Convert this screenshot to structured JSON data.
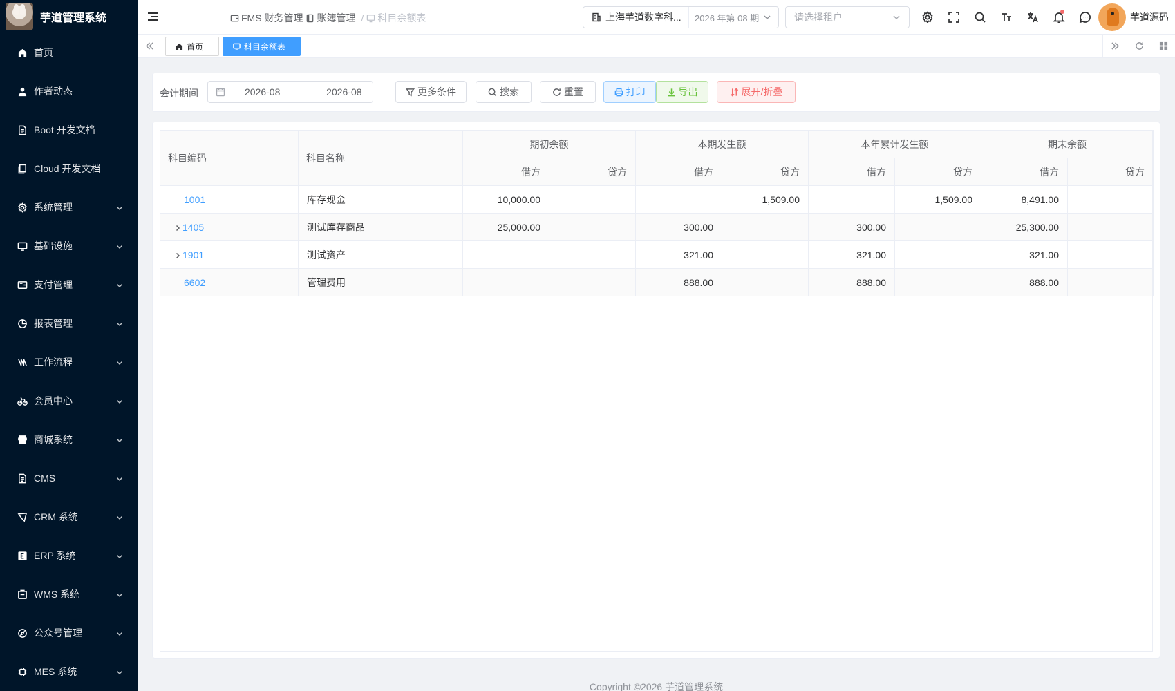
{
  "app": {
    "title": "芋道管理系统"
  },
  "sidebar": {
    "items": [
      {
        "label": "首页",
        "icon": "home-icon",
        "expandable": false
      },
      {
        "label": "作者动态",
        "icon": "user-icon",
        "expandable": false
      },
      {
        "label": "Boot 开发文档",
        "icon": "document-icon",
        "expandable": false
      },
      {
        "label": "Cloud 开发文档",
        "icon": "documents-icon",
        "expandable": false
      },
      {
        "label": "系统管理",
        "icon": "gear-icon",
        "expandable": true
      },
      {
        "label": "基础设施",
        "icon": "monitor-icon",
        "expandable": true
      },
      {
        "label": "支付管理",
        "icon": "wallet-icon",
        "expandable": true
      },
      {
        "label": "报表管理",
        "icon": "pie-chart-icon",
        "expandable": true
      },
      {
        "label": "工作流程",
        "icon": "workflow-icon",
        "expandable": true
      },
      {
        "label": "会员中心",
        "icon": "bicycle-icon",
        "expandable": true
      },
      {
        "label": "商城系统",
        "icon": "shop-icon",
        "expandable": true
      },
      {
        "label": "CMS",
        "icon": "file-text-icon",
        "expandable": true
      },
      {
        "label": "CRM 系统",
        "icon": "tag-icon",
        "expandable": true
      },
      {
        "label": "ERP 系统",
        "icon": "erp-icon",
        "expandable": true
      },
      {
        "label": "WMS 系统",
        "icon": "warehouse-icon",
        "expandable": true
      },
      {
        "label": "公众号管理",
        "icon": "compass-icon",
        "expandable": true
      },
      {
        "label": "MES 系统",
        "icon": "chip-icon",
        "expandable": true
      }
    ]
  },
  "header": {
    "breadcrumb": [
      "FMS 财务管理",
      "账簿管理",
      "科目余额表"
    ],
    "company": "上海芋道数字科...",
    "period": "2026 年第 08 期",
    "tenant_placeholder": "请选择租户",
    "username": "芋道源码"
  },
  "tags": [
    {
      "label": "首页",
      "active": false
    },
    {
      "label": "科目余额表",
      "active": true
    }
  ],
  "search": {
    "period_label": "会计期间",
    "period_start": "2026-08",
    "period_sep": "–",
    "period_end": "2026-08",
    "more_label": "更多条件",
    "search_label": "搜索",
    "reset_label": "重置",
    "print_label": "打印",
    "export_label": "导出",
    "toggle_label": "展开/折叠"
  },
  "table": {
    "col_code": "科目编码",
    "col_name": "科目名称",
    "groups": [
      "期初余额",
      "本期发生额",
      "本年累计发生额",
      "期末余额"
    ],
    "debit": "借方",
    "credit": "贷方",
    "rows": [
      {
        "code": "1001",
        "name": "库存现金",
        "expandable": false,
        "values": [
          "10,000.00",
          "",
          "",
          "1,509.00",
          "",
          "1,509.00",
          "8,491.00",
          ""
        ]
      },
      {
        "code": "1405",
        "name": "测试库存商品",
        "expandable": true,
        "values": [
          "25,000.00",
          "",
          "300.00",
          "",
          "300.00",
          "",
          "25,300.00",
          ""
        ]
      },
      {
        "code": "1901",
        "name": "测试资产",
        "expandable": true,
        "values": [
          "",
          "",
          "321.00",
          "",
          "321.00",
          "",
          "321.00",
          ""
        ]
      },
      {
        "code": "6602",
        "name": "管理费用",
        "expandable": false,
        "values": [
          "",
          "",
          "888.00",
          "",
          "888.00",
          "",
          "888.00",
          ""
        ]
      }
    ]
  },
  "footer": {
    "text": "Copyright ©2026 芋道管理系统"
  }
}
